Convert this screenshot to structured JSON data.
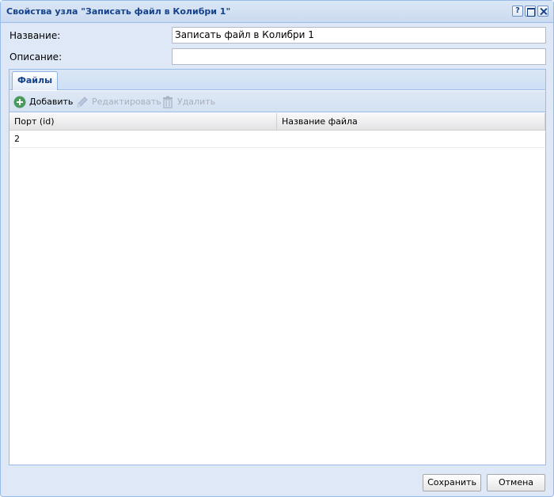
{
  "window": {
    "title": "Свойства узла \"Записать файл в Колибри 1\"",
    "tools": {
      "help": "?",
      "maximize": "",
      "close": ""
    }
  },
  "form": {
    "name_label": "Название:",
    "name_value": "Записать файл в Колибри 1",
    "description_label": "Описание:",
    "description_value": ""
  },
  "tabs": [
    {
      "label": "Файлы",
      "active": true
    }
  ],
  "toolbar": {
    "add_label": "Добавить",
    "add_icon": "plus-circle-icon",
    "edit_label": "Редактировать",
    "edit_icon": "pencil-icon",
    "delete_label": "Удалить",
    "delete_icon": "trash-icon"
  },
  "grid": {
    "columns": [
      "Порт (id)",
      "Название файла"
    ],
    "rows": [
      [
        "2",
        ""
      ]
    ]
  },
  "footer": {
    "save_label": "Сохранить",
    "cancel_label": "Отмена"
  },
  "colors": {
    "title_text": "#15428b",
    "window_bg": "#dfe8f6",
    "border": "#99bbe8",
    "add_icon": "#4a9a5c",
    "disabled_text": "#a8b0bc"
  }
}
